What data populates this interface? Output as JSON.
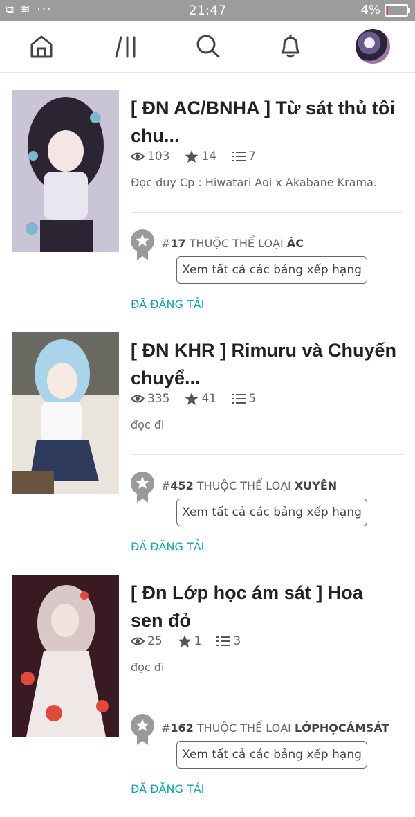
{
  "status_bar": {
    "left_icons": "⧉ ≋ ···",
    "time": "21:47",
    "battery": "4%",
    "battery_level": 0.04
  },
  "nav": {
    "items": [
      {
        "name": "home",
        "icon": "home-icon"
      },
      {
        "name": "library",
        "icon": "library-icon"
      },
      {
        "name": "search",
        "icon": "search-icon"
      },
      {
        "name": "notifications",
        "icon": "bell-icon"
      },
      {
        "name": "profile",
        "icon": "avatar"
      }
    ]
  },
  "stories": [
    {
      "title": "[ ĐN AC/BNHA ] Từ sát thủ tôi chu...",
      "views": "103",
      "votes": "14",
      "parts": "7",
      "description": "Đọc duy Cp : Hiwatari Aoi x Akabane Krama.",
      "rank_prefix": "#",
      "rank": "17",
      "rank_text": " THUỘC THỂ LOẠI ",
      "category": "ÁC",
      "rankings_button": "Xem tất cả các bảng xếp hạng",
      "status": "ĐÃ ĐĂNG TẢI",
      "cover_colors": [
        "#c9c4d6",
        "#2b2533",
        "#7fb7cf"
      ]
    },
    {
      "title": "[ ĐN KHR ] Rimuru và Chuyến chuyể...",
      "views": "335",
      "votes": "41",
      "parts": "5",
      "description": "đọc đi",
      "rank_prefix": "#",
      "rank": "452",
      "rank_text": " THUỘC THỂ LOẠI ",
      "category": "XUYÊN",
      "rankings_button": "Xem tất cả các bảng xếp hạng",
      "status": "ĐÃ ĐĂNG TẢI",
      "cover_colors": [
        "#e9e4dc",
        "#a9d4ea",
        "#2f3b5c"
      ]
    },
    {
      "title": "[ Đn Lớp học ám sát ] Hoa sen đỏ",
      "views": "25",
      "votes": "1",
      "parts": "3",
      "description": "đọc đi",
      "rank_prefix": "#",
      "rank": "162",
      "rank_text": " THUỘC THỂ LOẠI ",
      "category": "LỚPHỌCÁMSÁT",
      "rankings_button": "Xem tất cả các bảng xếp hạng",
      "status": "ĐÃ ĐĂNG TẢI",
      "cover_colors": [
        "#3a1a22",
        "#d8c8c8",
        "#e04a3a"
      ]
    }
  ]
}
